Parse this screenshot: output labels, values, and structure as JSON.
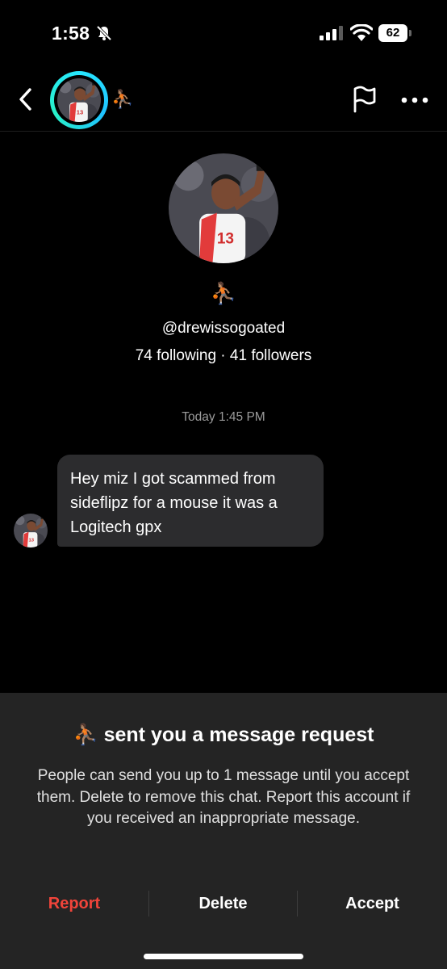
{
  "status_bar": {
    "time": "1:58",
    "battery": "62"
  },
  "nav": {
    "emoji": "⛹🏽"
  },
  "profile": {
    "emoji": "⛹🏽",
    "username": "@drewissogoated",
    "stats": "74 following · 41 followers"
  },
  "conversation": {
    "timestamp": "Today 1:45 PM",
    "message": "Hey miz I got scammed from sideflipz for a mouse it was a Logitech gpx"
  },
  "request_sheet": {
    "title": "⛹🏽 sent you a message request",
    "body": "People can send you up to 1 message until you accept them. Delete to remove this chat. Report this account if you received an inappropriate message.",
    "report_label": "Report",
    "delete_label": "Delete",
    "accept_label": "Accept"
  },
  "colors": {
    "report": "#f0443a",
    "bubble": "#2c2c2e",
    "sheet": "#242424",
    "avatar_ring": "#27e7ff"
  }
}
